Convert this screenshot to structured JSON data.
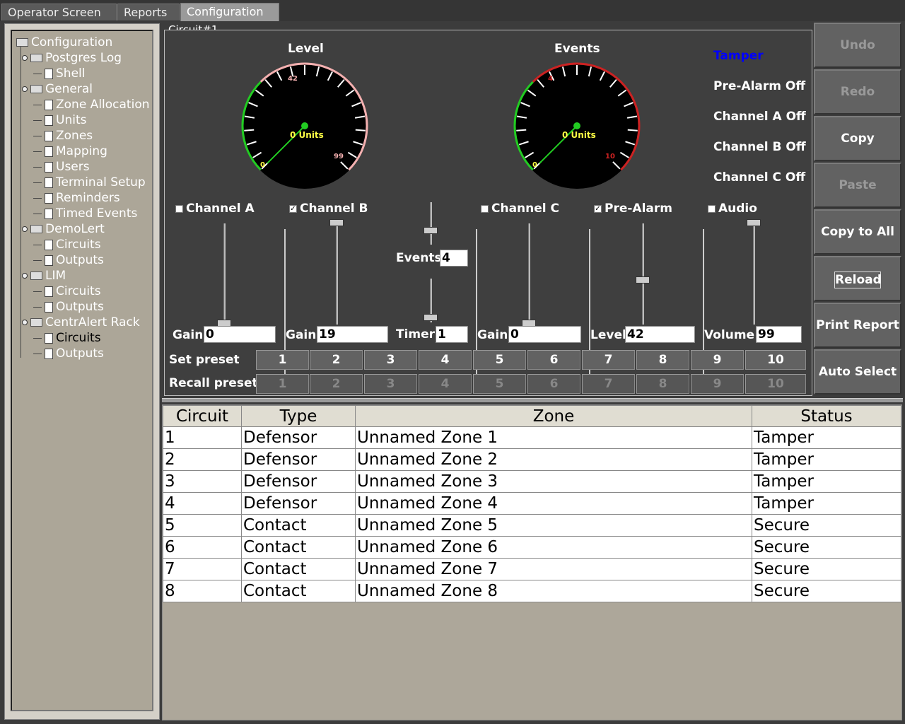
{
  "tabs": [
    {
      "label": "Operator Screen"
    },
    {
      "label": "Reports"
    },
    {
      "label": "Configuration"
    }
  ],
  "tree": {
    "root": "Configuration",
    "nodes": [
      {
        "label": "Postgres Log",
        "type": "folder"
      },
      {
        "label": "Shell",
        "type": "doc"
      },
      {
        "label": "General",
        "type": "folder"
      },
      {
        "label": "Zone Allocation",
        "type": "doc"
      },
      {
        "label": "Units",
        "type": "doc"
      },
      {
        "label": "Zones",
        "type": "doc"
      },
      {
        "label": "Mapping",
        "type": "doc"
      },
      {
        "label": "Users",
        "type": "doc"
      },
      {
        "label": "Terminal Setup",
        "type": "doc"
      },
      {
        "label": "Reminders",
        "type": "doc"
      },
      {
        "label": "Timed Events",
        "type": "doc"
      },
      {
        "label": "DemoLert",
        "type": "folder"
      },
      {
        "label": "Circuits",
        "type": "doc"
      },
      {
        "label": "Outputs",
        "type": "doc"
      },
      {
        "label": "LIM",
        "type": "folder"
      },
      {
        "label": "Circuits",
        "type": "doc"
      },
      {
        "label": "Outputs",
        "type": "doc"
      },
      {
        "label": "CentrAlert Rack",
        "type": "folder"
      },
      {
        "label": "Circuits",
        "type": "doc"
      },
      {
        "label": "Outputs",
        "type": "doc"
      }
    ]
  },
  "circuit": {
    "title": "Circuit#1",
    "level_gauge": {
      "title": "Level",
      "value_text": "0 Units",
      "min_label": "0",
      "mark_label": "42",
      "max_label": "99",
      "value": 0
    },
    "events_gauge": {
      "title": "Events",
      "value_text": "0 Units",
      "min_label": "0",
      "mark_label": "4",
      "max_label": "10",
      "value": 0
    },
    "alarms": {
      "tamper": "Tamper",
      "pre_alarm": "Pre-Alarm Off",
      "channel_a": "Channel A Off",
      "channel_b": "Channel B Off",
      "channel_c": "Channel C Off",
      "tamper_color": "#0000ff"
    },
    "channel_a": {
      "label": "Channel A",
      "checked": false,
      "field_label": "Gain",
      "value": "0"
    },
    "channel_b": {
      "label": "Channel B",
      "checked": true,
      "field_label": "Gain",
      "value": "19"
    },
    "events": {
      "label": "Events",
      "value": "4",
      "timer_label": "Timer",
      "timer_value": "1"
    },
    "channel_c": {
      "label": "Channel C",
      "checked": false,
      "field_label": "Gain",
      "value": "0"
    },
    "pre_alarm": {
      "label": "Pre-Alarm",
      "checked": true,
      "field_label": "Level",
      "value": "42"
    },
    "audio": {
      "label": "Audio",
      "checked": false,
      "field_label": "Volume",
      "value": "99"
    },
    "set_preset_label": "Set preset",
    "recall_preset_label": "Recall preset",
    "presets": [
      "1",
      "2",
      "3",
      "4",
      "5",
      "6",
      "7",
      "8",
      "9",
      "10"
    ]
  },
  "actions": {
    "undo": "Undo",
    "redo": "Redo",
    "copy": "Copy",
    "paste": "Paste",
    "copy_to_all": "Copy to All",
    "reload": "Reload",
    "print_report": "Print Report",
    "auto_select": "Auto Select"
  },
  "table": {
    "headers": [
      "Circuit",
      "Type",
      "Zone",
      "Status"
    ],
    "rows": [
      [
        "1",
        "Defensor",
        "Unnamed Zone 1",
        "Tamper"
      ],
      [
        "2",
        "Defensor",
        "Unnamed Zone 2",
        "Tamper"
      ],
      [
        "3",
        "Defensor",
        "Unnamed Zone 3",
        "Tamper"
      ],
      [
        "4",
        "Defensor",
        "Unnamed Zone 4",
        "Tamper"
      ],
      [
        "5",
        "Contact",
        "Unnamed Zone 5",
        "Secure"
      ],
      [
        "6",
        "Contact",
        "Unnamed Zone 6",
        "Secure"
      ],
      [
        "7",
        "Contact",
        "Unnamed Zone 7",
        "Secure"
      ],
      [
        "8",
        "Contact",
        "Unnamed Zone 8",
        "Secure"
      ]
    ]
  },
  "colors": {
    "gauge_green": "#22cc22",
    "gauge_red": "#cc2222",
    "gauge_pink": "#f4b0b0"
  }
}
